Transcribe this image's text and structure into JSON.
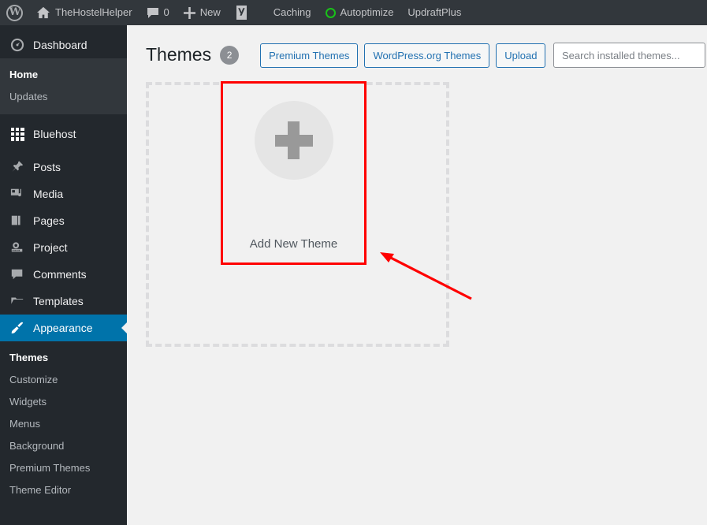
{
  "adminbar": {
    "items": [
      {
        "icon": "wordpress-logo-icon",
        "label": ""
      },
      {
        "icon": "home-icon",
        "label": "TheHostelHelper"
      },
      {
        "icon": "comment-bubble-icon",
        "label": "0"
      },
      {
        "icon": "plus-icon",
        "label": "New"
      },
      {
        "icon": "yoast-seo-icon",
        "label": ""
      },
      {
        "icon": "",
        "label": "Caching"
      },
      {
        "icon": "green-circle-icon",
        "label": "Autoptimize"
      },
      {
        "icon": "",
        "label": "UpdraftPlus"
      }
    ]
  },
  "sidebar": {
    "items": [
      {
        "label": "Dashboard",
        "icon": "dashboard-icon",
        "current": false
      },
      {
        "label": "Bluehost",
        "icon": "bluehost-grid-icon",
        "current": false
      },
      {
        "label": "Posts",
        "icon": "pin-icon",
        "current": false
      },
      {
        "label": "Media",
        "icon": "media-icon",
        "current": false
      },
      {
        "label": "Pages",
        "icon": "pages-icon",
        "current": false
      },
      {
        "label": "Project",
        "icon": "project-film-icon",
        "current": false
      },
      {
        "label": "Comments",
        "icon": "comment-icon",
        "current": false
      },
      {
        "label": "Templates",
        "icon": "folder-icon",
        "current": false
      },
      {
        "label": "Appearance",
        "icon": "paintbrush-icon",
        "current": true
      }
    ],
    "dashboard_submenu": [
      {
        "label": "Home",
        "active": true
      },
      {
        "label": "Updates",
        "active": false
      }
    ],
    "appearance_submenu": [
      {
        "label": "Themes",
        "active": true
      },
      {
        "label": "Customize",
        "active": false
      },
      {
        "label": "Widgets",
        "active": false
      },
      {
        "label": "Menus",
        "active": false
      },
      {
        "label": "Background",
        "active": false
      },
      {
        "label": "Premium Themes",
        "active": false
      },
      {
        "label": "Theme Editor",
        "active": false
      }
    ]
  },
  "page": {
    "title": "Themes",
    "count": "2",
    "buttons": [
      {
        "label": "Premium Themes",
        "name": "premium-themes-button"
      },
      {
        "label": "WordPress.org Themes",
        "name": "wordpress-org-themes-button"
      },
      {
        "label": "Upload",
        "name": "upload-theme-button"
      }
    ],
    "search": {
      "placeholder": "Search installed themes...",
      "value": ""
    },
    "add_theme": {
      "label": "Add New Theme",
      "icon": "plus-icon"
    }
  },
  "annotation": {
    "box_color": "#ff0000",
    "arrow_color": "#ff0000",
    "target": "Add New Theme"
  }
}
